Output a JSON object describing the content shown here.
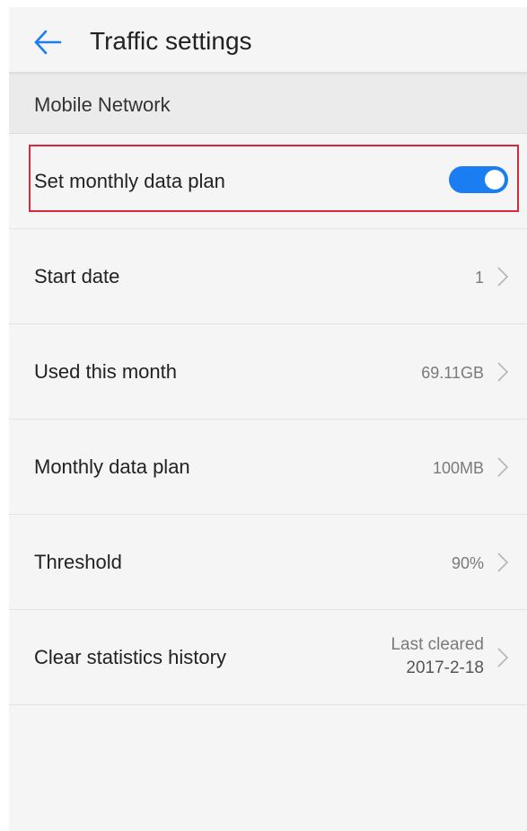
{
  "header": {
    "title": "Traffic settings",
    "back_icon": "arrow-left-icon",
    "accent_color": "#1a7ef2"
  },
  "section": {
    "label": "Mobile Network"
  },
  "rows": [
    {
      "label": "Set monthly data plan",
      "toggle_on": true,
      "highlighted": true
    },
    {
      "label": "Start date",
      "value": "1"
    },
    {
      "label": "Used this month",
      "value": "69.11GB"
    },
    {
      "label": "Monthly data plan",
      "value": "100MB"
    },
    {
      "label": "Threshold",
      "value": "90%"
    },
    {
      "label": "Clear statistics history",
      "value_line1": "Last cleared",
      "value_line2": "2017-2-18"
    }
  ],
  "icons": {
    "chevron": "chevron-right-icon",
    "toggle": "toggle-switch"
  },
  "colors": {
    "highlight_border": "#d9283a",
    "toggle_on": "#1a7ef2"
  }
}
